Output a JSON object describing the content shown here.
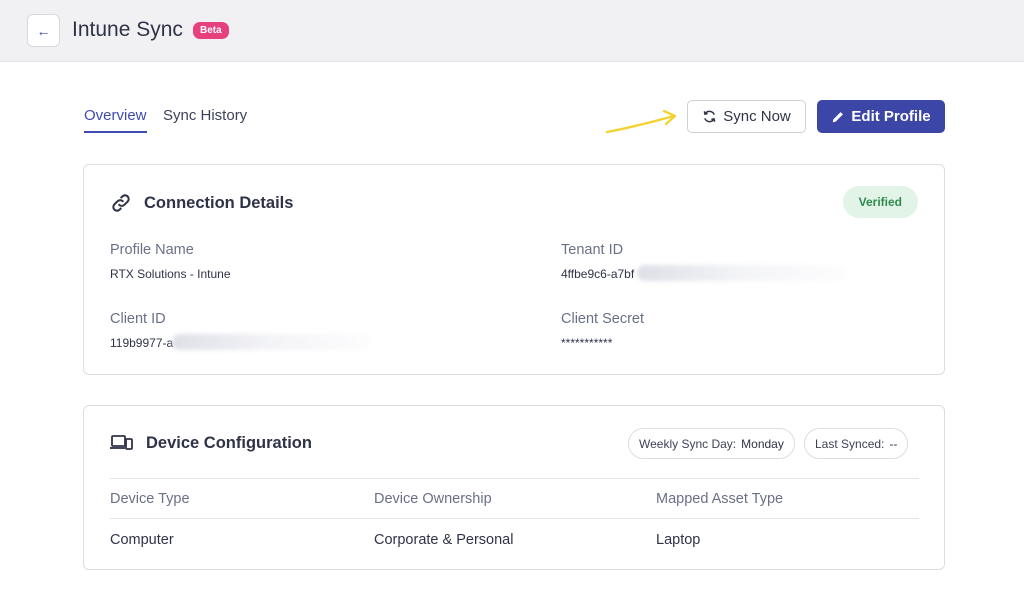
{
  "header": {
    "title": "Intune Sync",
    "badge": "Beta",
    "back_icon": "←"
  },
  "tabs": [
    {
      "label": "Overview",
      "active": true
    },
    {
      "label": "Sync History",
      "active": false
    }
  ],
  "actions": {
    "sync_label": "Sync Now",
    "edit_label": "Edit Profile"
  },
  "connection": {
    "title": "Connection Details",
    "status": "Verified",
    "profile_name_label": "Profile Name",
    "profile_name_value": "RTX Solutions - Intune",
    "tenant_id_label": "Tenant ID",
    "tenant_id_value": "4ffbe9c6-a7bf",
    "client_id_label": "Client ID",
    "client_id_value": "119b9977-a",
    "client_secret_label": "Client Secret",
    "client_secret_value": "***********"
  },
  "device": {
    "title": "Device Configuration",
    "weekly_sync_label": "Weekly Sync Day:",
    "weekly_sync_value": "Monday",
    "last_synced_label": "Last Synced:",
    "last_synced_value": "--",
    "columns": [
      "Device Type",
      "Device Ownership",
      "Mapped Asset Type"
    ],
    "row": [
      "Computer",
      "Corporate & Personal",
      "Laptop"
    ]
  },
  "colors": {
    "accent": "#3c46a6",
    "badge": "#e8407e",
    "verified_bg": "#e2f4e7",
    "verified_text": "#2f8a4e",
    "arrow": "#f2d332"
  }
}
